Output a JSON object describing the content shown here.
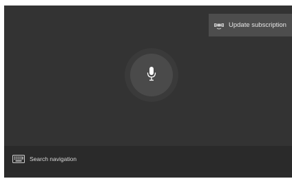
{
  "subscription_button": {
    "label": "Update subscription",
    "icon": "satellite-icon"
  },
  "voice": {
    "icon": "microphone-icon"
  },
  "search": {
    "placeholder": "Search navigation",
    "icon": "keyboard-icon"
  },
  "colors": {
    "screen_background": "#333333",
    "button_background": "#4d4d4d",
    "search_bar_background": "#2a2a2a",
    "text": "#e6e6e6"
  }
}
